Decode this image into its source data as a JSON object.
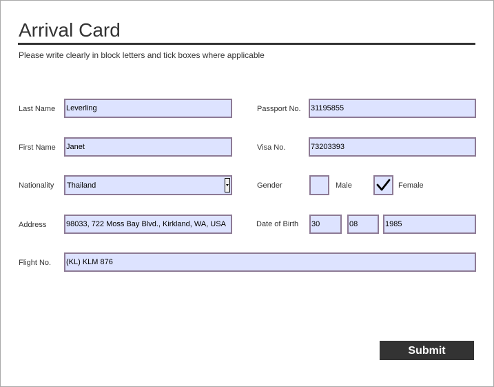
{
  "form": {
    "title": "Arrival Card",
    "instructions": "Please write clearly in block letters and tick boxes where applicable",
    "last_name": {
      "label": "Last Name",
      "value": "Leverling"
    },
    "first_name": {
      "label": "First Name",
      "value": "Janet"
    },
    "nationality": {
      "label": "Nationality",
      "value": "Thailand"
    },
    "address": {
      "label": "Address",
      "value": "98033, 722 Moss Bay Blvd., Kirkland, WA, USA"
    },
    "flight_no": {
      "label": "Flight No.",
      "value": "(KL) KLM 876"
    },
    "passport_no": {
      "label": "Passport No.",
      "value": "31195855"
    },
    "visa_no": {
      "label": "Visa No.",
      "value": "73203393"
    },
    "gender": {
      "label": "Gender",
      "male": {
        "label": "Male",
        "checked": false
      },
      "female": {
        "label": "Female",
        "checked": true
      }
    },
    "date_of_birth": {
      "label": "Date of Birth",
      "day": "30",
      "month": "08",
      "year": "1985"
    },
    "submit_label": "Submit"
  },
  "colors": {
    "field_background": "#dde3ff",
    "field_border": "#8d7a95",
    "text": "#333333",
    "button_background": "#333333",
    "button_text": "#ffffff"
  }
}
